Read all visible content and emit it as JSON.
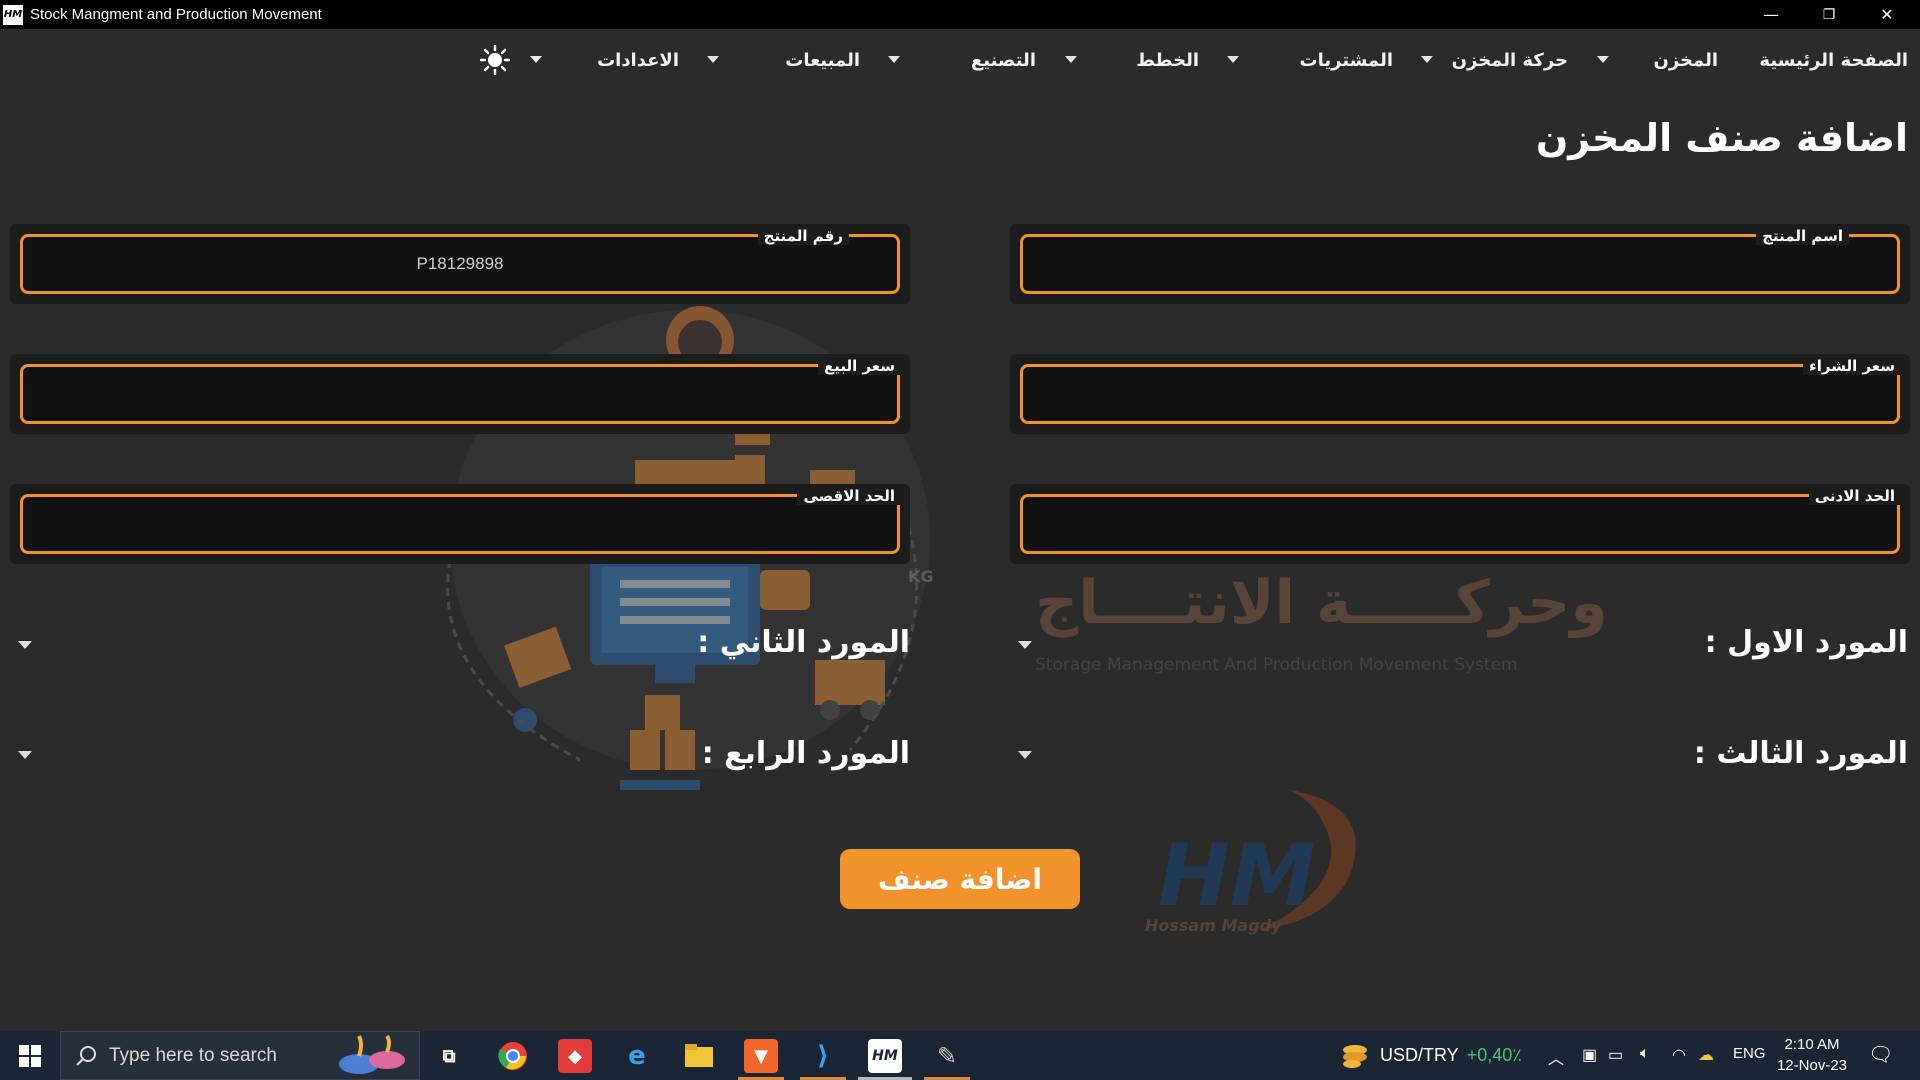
{
  "window": {
    "title": "Stock Mangment and Production Movement",
    "app_icon_text": "HM",
    "minimize": "—",
    "restore": "❐",
    "close": "✕"
  },
  "menu": {
    "items": [
      {
        "label": "الصفحة الرئيسية"
      },
      {
        "label": "المخزن"
      },
      {
        "label": "حركة المخزن"
      },
      {
        "label": "المشتريات"
      },
      {
        "label": "الخطط"
      },
      {
        "label": "التصنيع"
      },
      {
        "label": "المبيعات"
      },
      {
        "label": "الاعدادات"
      }
    ],
    "theme_icon": "sun-icon"
  },
  "page": {
    "title": "اضافة صنف المخزن"
  },
  "form": {
    "product_name": {
      "label": "اسم المنتج",
      "value": ""
    },
    "product_number": {
      "label": "رقم المنتج",
      "value": "P18129898"
    },
    "purchase_price": {
      "label": "سعر الشراء",
      "value": ""
    },
    "sale_price": {
      "label": "سعر البيع",
      "value": ""
    },
    "min_limit": {
      "label": "الحد الادنى",
      "value": ""
    },
    "max_limit": {
      "label": "الحد الاقصى",
      "value": ""
    },
    "supplier_1": {
      "label": "المورد الاول :"
    },
    "supplier_2": {
      "label": "المورد الثاني :"
    },
    "supplier_3": {
      "label": "المورد الثالث :"
    },
    "supplier_4": {
      "label": "المورد الرابع :"
    },
    "submit_label": "اضافة صنف"
  },
  "watermark": {
    "arabic": "وحركـــــة الانتــــاج",
    "english": "Storage Management And Production Movement System",
    "logo_text": "HM",
    "logo_sub": "Hossam Magdy",
    "kg_label": "KG"
  },
  "taskbar": {
    "search_placeholder": "Type here to search",
    "ticker_symbol": "USD/TRY",
    "ticker_change": "+0,40٪",
    "language": "ENG",
    "time": "2:10 AM",
    "date": "12-Nov-23",
    "accent": "#f2922a"
  }
}
